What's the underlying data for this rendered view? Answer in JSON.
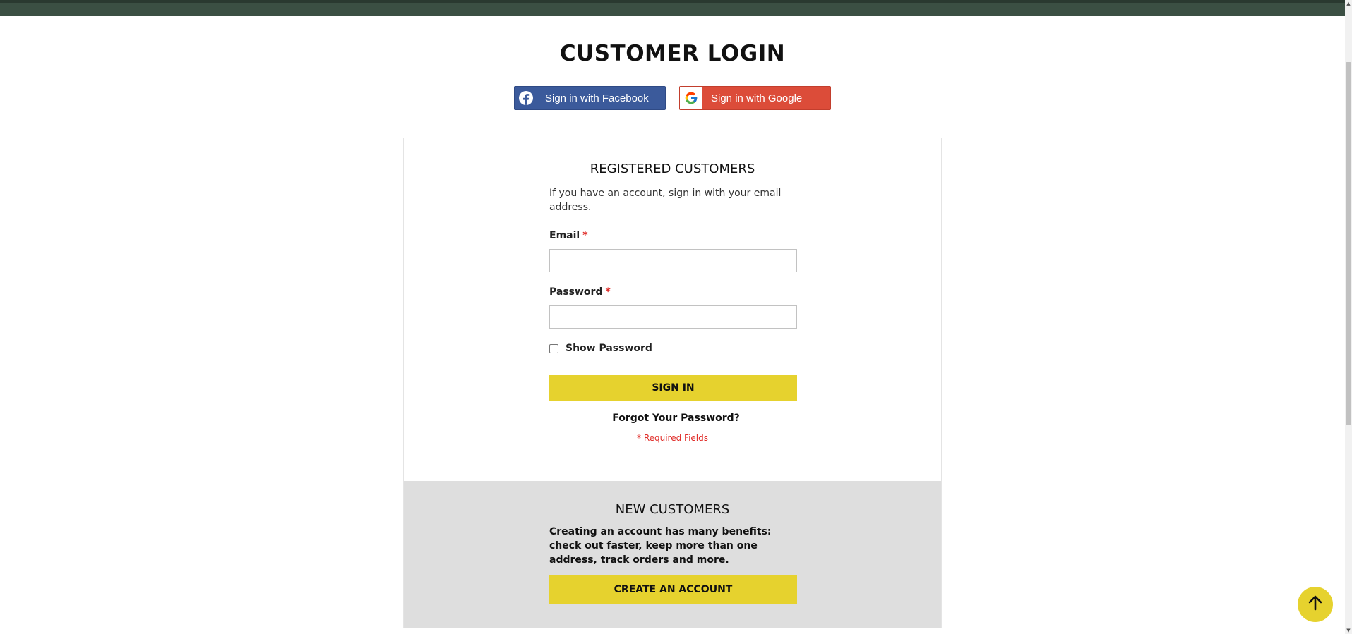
{
  "page": {
    "title": "CUSTOMER LOGIN"
  },
  "social": {
    "facebook_label": "Sign in with Facebook",
    "google_label": "Sign in with Google",
    "facebook_color": "#3b5a9b",
    "google_color": "#dc4c39"
  },
  "registered": {
    "heading": "REGISTERED CUSTOMERS",
    "intro": "If you have an account, sign in with your email address.",
    "email_label": "Email",
    "email_value": "",
    "password_label": "Password",
    "password_value": "",
    "required_mark": "*",
    "show_password_label": "Show Password",
    "show_password_checked": false,
    "sign_in_label": "SIGN IN",
    "forgot_label": "Forgot Your Password?",
    "required_note": "* Required Fields"
  },
  "new_customers": {
    "heading": "NEW CUSTOMERS",
    "text": "Creating an account has many benefits: check out faster, keep more than one address, track orders and more.",
    "create_label": "CREATE AN ACCOUNT"
  },
  "colors": {
    "accent_yellow": "#e6d22e",
    "required_red": "#e02b27",
    "top_bar": "#3b4f43"
  },
  "icons": {
    "facebook": "facebook-icon",
    "google": "google-icon",
    "scroll_top": "arrow-up-icon"
  }
}
